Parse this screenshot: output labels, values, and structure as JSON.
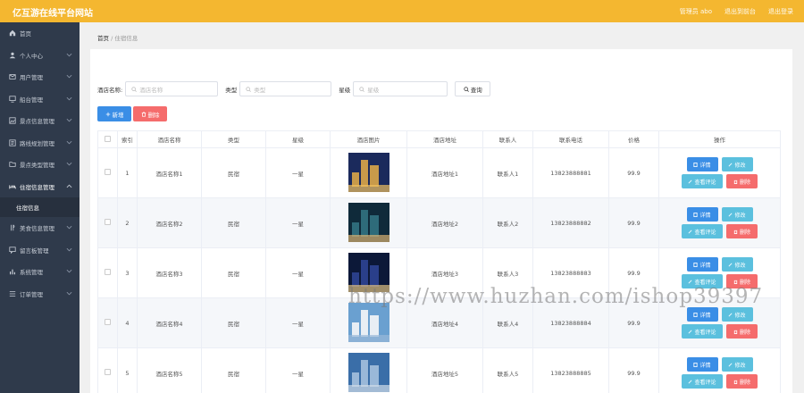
{
  "topbar": {
    "brand": "亿互游在线平台网站",
    "admin": "管理员 abo",
    "exit_frontend": "退出到前台",
    "logout": "退出登录",
    "bg_color": "#f4b730"
  },
  "sidebar": {
    "bg_color": "#2f3a4b",
    "items": [
      {
        "label": "首页",
        "icon": "home-icon"
      },
      {
        "label": "个人中心",
        "icon": "user-icon"
      },
      {
        "label": "用户管理",
        "icon": "mail-icon"
      },
      {
        "label": "船台管理",
        "icon": "monitor-icon"
      },
      {
        "label": "景点信息管理",
        "icon": "image-icon"
      },
      {
        "label": "路线规划管理",
        "icon": "route-icon"
      },
      {
        "label": "景点类型管理",
        "icon": "folder-icon"
      },
      {
        "label": "住宿信息管理",
        "icon": "bed-icon"
      },
      {
        "label": "美食信息管理",
        "icon": "food-icon"
      },
      {
        "label": "留言板管理",
        "icon": "message-icon"
      },
      {
        "label": "系统管理",
        "icon": "chart-icon"
      },
      {
        "label": "订单管理",
        "icon": "list-icon"
      }
    ],
    "active_sub": "住宿信息"
  },
  "breadcrumb": {
    "home": "首页",
    "sep": "/",
    "current": "住宿信息"
  },
  "search": {
    "hotel_label": "酒店名称:",
    "hotel_placeholder": "酒店名称",
    "type_label": "类型",
    "type_placeholder": "类型",
    "star_label": "星级",
    "star_placeholder": "星级",
    "query_button": "查询"
  },
  "actions": {
    "add": "新增",
    "delete": "删除"
  },
  "table": {
    "headers": [
      "",
      "索引",
      "酒店名称",
      "类型",
      "星级",
      "酒店图片",
      "酒店地址",
      "联系人",
      "联系电话",
      "价格",
      "操作"
    ],
    "rows": [
      {
        "idx": "1",
        "name": "酒店名称1",
        "type": "民宿",
        "star": "一星",
        "address": "酒店地址1",
        "contact": "联系人1",
        "phone": "13823888881",
        "price": "99.9"
      },
      {
        "idx": "2",
        "name": "酒店名称2",
        "type": "民宿",
        "star": "一星",
        "address": "酒店地址2",
        "contact": "联系人2",
        "phone": "13823888882",
        "price": "99.9"
      },
      {
        "idx": "3",
        "name": "酒店名称3",
        "type": "民宿",
        "star": "一星",
        "address": "酒店地址3",
        "contact": "联系人3",
        "phone": "13823888883",
        "price": "99.9"
      },
      {
        "idx": "4",
        "name": "酒店名称4",
        "type": "民宿",
        "star": "一星",
        "address": "酒店地址4",
        "contact": "联系人4",
        "phone": "13823888884",
        "price": "99.9"
      },
      {
        "idx": "5",
        "name": "酒店名称5",
        "type": "民宿",
        "star": "一星",
        "address": "酒店地址5",
        "contact": "联系人5",
        "phone": "13823888885",
        "price": "99.9"
      }
    ],
    "ops": {
      "detail": "详情",
      "edit": "修改",
      "review": "查看评论",
      "remove": "删除"
    }
  },
  "watermark": "https://www.huzhan.com/ishop39397"
}
